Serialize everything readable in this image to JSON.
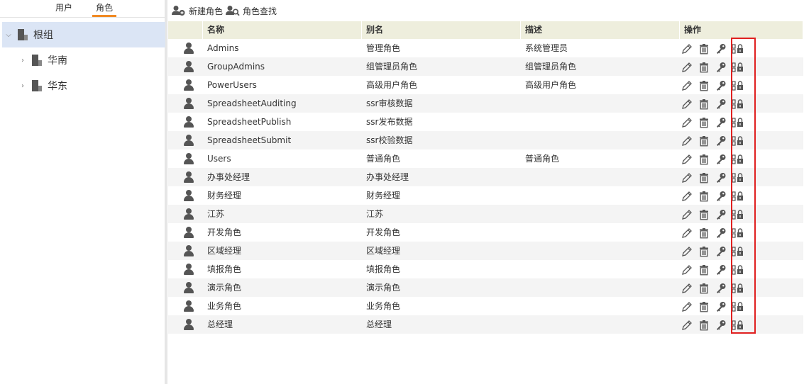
{
  "left_panel": {
    "tabs": [
      {
        "label": "用户",
        "active": false
      },
      {
        "label": "角色",
        "active": true
      }
    ],
    "tree": {
      "root": {
        "label": "根组",
        "expanded": true
      },
      "children": [
        {
          "label": "华南",
          "expanded": false
        },
        {
          "label": "华东",
          "expanded": false
        }
      ]
    }
  },
  "toolbar": {
    "new_role_label": "新建角色",
    "find_role_label": "角色查找"
  },
  "grid": {
    "columns": [
      "名称",
      "别名",
      "描述",
      "操作"
    ],
    "rows": [
      {
        "name": "Admins",
        "alias": "管理角色",
        "desc": "系统管理员"
      },
      {
        "name": "GroupAdmins",
        "alias": "组管理员角色",
        "desc": "组管理员角色"
      },
      {
        "name": "PowerUsers",
        "alias": "高级用户角色",
        "desc": "高级用户角色"
      },
      {
        "name": "SpreadsheetAuditing",
        "alias": "ssr审核数据",
        "desc": ""
      },
      {
        "name": "SpreadsheetPublish",
        "alias": "ssr发布数据",
        "desc": ""
      },
      {
        "name": "SpreadsheetSubmit",
        "alias": "ssr校验数据",
        "desc": ""
      },
      {
        "name": "Users",
        "alias": "普通角色",
        "desc": "普通角色"
      },
      {
        "name": "办事处经理",
        "alias": "办事处经理",
        "desc": ""
      },
      {
        "name": "财务经理",
        "alias": "财务经理",
        "desc": ""
      },
      {
        "name": "江苏",
        "alias": "江苏",
        "desc": ""
      },
      {
        "name": "开发角色",
        "alias": "开发角色",
        "desc": ""
      },
      {
        "name": "区域经理",
        "alias": "区域经理",
        "desc": ""
      },
      {
        "name": "填报角色",
        "alias": "填报角色",
        "desc": ""
      },
      {
        "name": "演示角色",
        "alias": "演示角色",
        "desc": ""
      },
      {
        "name": "业务角色",
        "alias": "业务角色",
        "desc": ""
      },
      {
        "name": "总经理",
        "alias": "总经理",
        "desc": ""
      }
    ],
    "row_actions": [
      "edit-icon",
      "delete-icon",
      "key-icon",
      "permission-lock-icon"
    ]
  },
  "colors": {
    "tab_active_underline": "#f08a24",
    "tree_selected_bg": "#dbe5f5",
    "grid_header_bg": "#eeeedd",
    "highlight_border": "#e02020"
  }
}
